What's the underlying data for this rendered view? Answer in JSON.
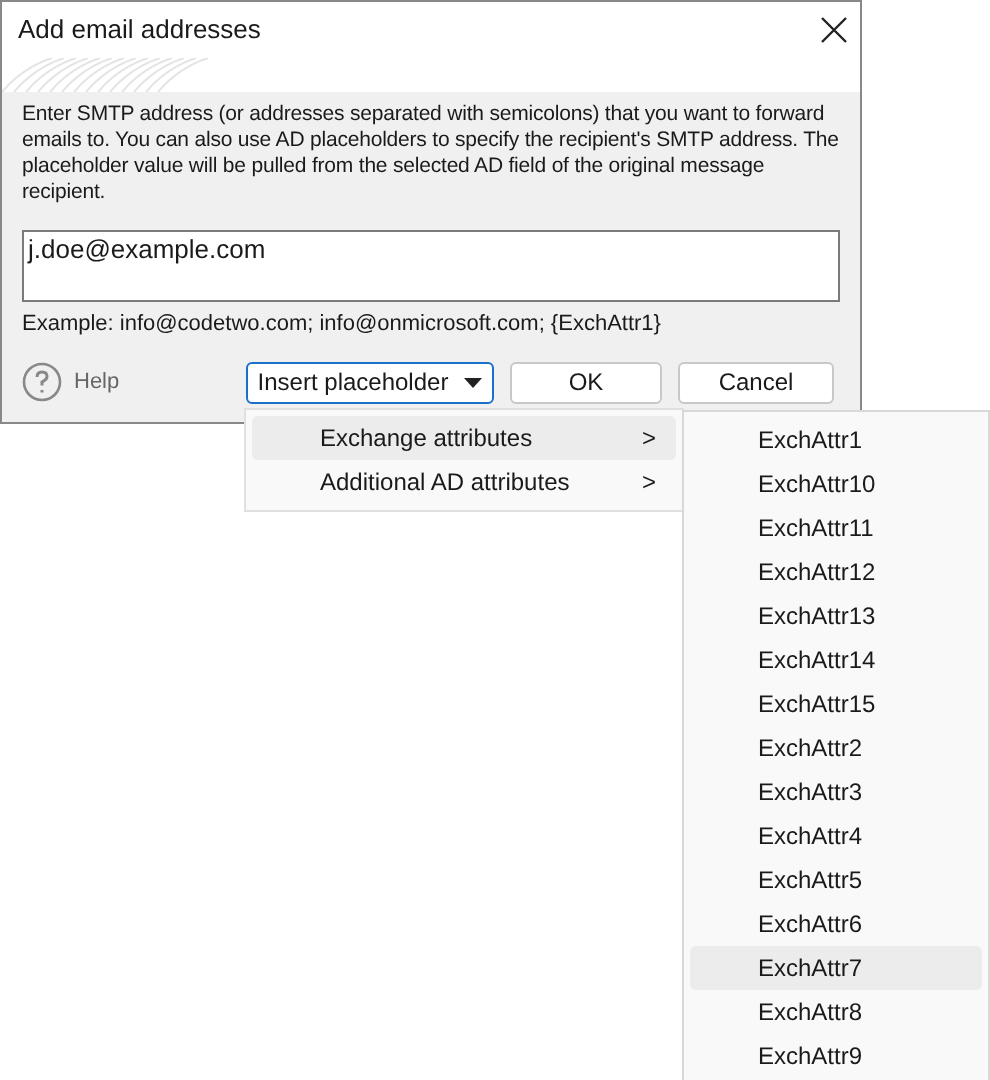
{
  "window": {
    "title": "Add email addresses"
  },
  "description": "Enter SMTP address (or addresses separated with semicolons) that you want to forward emails to. You can also use AD placeholders to specify the recipient's SMTP address. The placeholder value will be pulled from the selected AD field of the original message recipient.",
  "address_field": {
    "value": "j.doe@example.com"
  },
  "example": "Example: info@codetwo.com; info@onmicrosoft.com; {ExchAttr1}",
  "help": {
    "label": "Help"
  },
  "buttons": [
    {
      "label": "Insert placeholder",
      "kind": "dropdown"
    },
    {
      "label": "OK",
      "kind": "plain"
    },
    {
      "label": "Cancel",
      "kind": "plain"
    }
  ],
  "menu": {
    "items": [
      {
        "label": "Exchange attributes",
        "selected": true,
        "arrow": ">"
      },
      {
        "label": "Additional AD attributes",
        "selected": false,
        "arrow": ">"
      }
    ]
  },
  "submenu": {
    "items": [
      {
        "label": "ExchAttr1",
        "selected": false
      },
      {
        "label": "ExchAttr10",
        "selected": false
      },
      {
        "label": "ExchAttr11",
        "selected": false
      },
      {
        "label": "ExchAttr12",
        "selected": false
      },
      {
        "label": "ExchAttr13",
        "selected": false
      },
      {
        "label": "ExchAttr14",
        "selected": false
      },
      {
        "label": "ExchAttr15",
        "selected": false
      },
      {
        "label": "ExchAttr2",
        "selected": false
      },
      {
        "label": "ExchAttr3",
        "selected": false
      },
      {
        "label": "ExchAttr4",
        "selected": false
      },
      {
        "label": "ExchAttr5",
        "selected": false
      },
      {
        "label": "ExchAttr6",
        "selected": false
      },
      {
        "label": "ExchAttr7",
        "selected": true
      },
      {
        "label": "ExchAttr8",
        "selected": false
      },
      {
        "label": "ExchAttr9",
        "selected": false
      }
    ]
  }
}
